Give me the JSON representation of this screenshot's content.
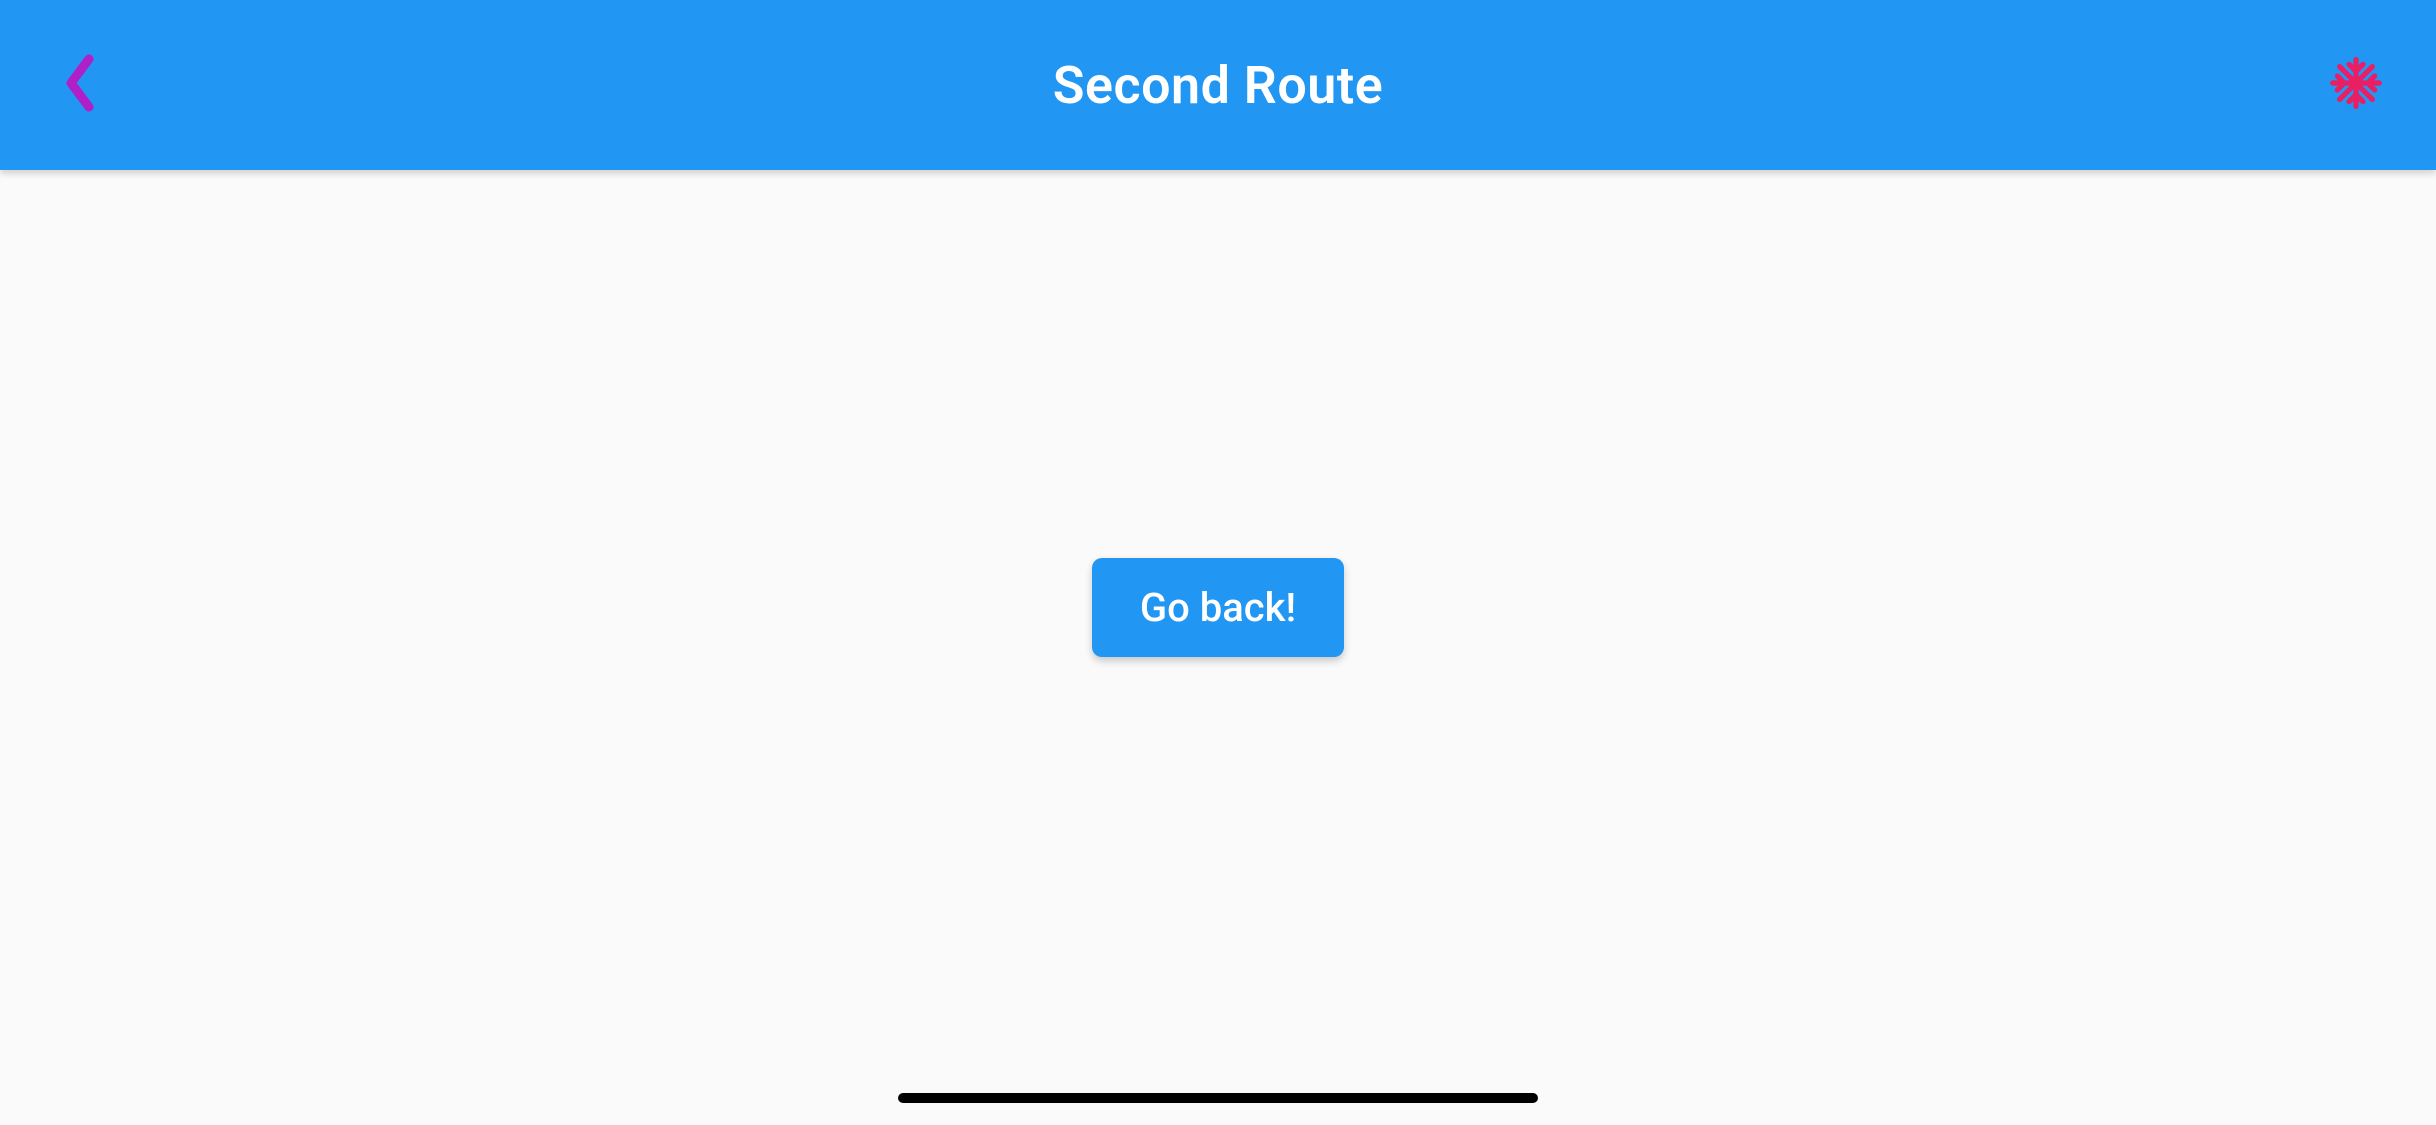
{
  "appBar": {
    "title": "Second Route",
    "backIconColor": "#b020c8",
    "actionIconColor": "#e91e63",
    "backgroundColor": "#2196F3"
  },
  "main": {
    "goBackLabel": "Go back!"
  }
}
